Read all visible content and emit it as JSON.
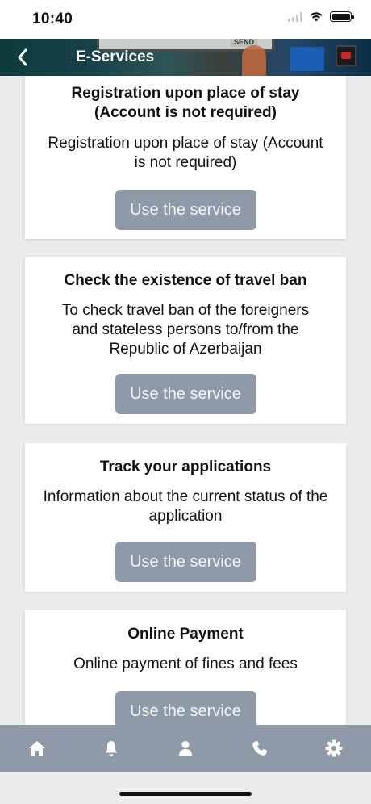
{
  "status_bar": {
    "time": "10:40"
  },
  "header": {
    "title": "E-Services",
    "deco_text": "SEND"
  },
  "cards": [
    {
      "title": "Registration upon place of stay (Account is not required)",
      "description": "Registration upon place of stay (Account is not required)",
      "button": "Use the service"
    },
    {
      "title": "Check the existence of travel ban",
      "description": "To check travel ban of the foreigners and stateless persons to/from the Republic of Azerbaijan",
      "button": "Use the service"
    },
    {
      "title": "Track your applications",
      "description": "Information about the current status of the application",
      "button": "Use the service"
    },
    {
      "title": "Online Payment",
      "description": "Online payment of fines and fees",
      "button": "Use the service"
    }
  ],
  "tab_bar": {
    "items": [
      "home-icon",
      "bell-icon",
      "person-icon",
      "phone-icon",
      "gear-icon"
    ]
  },
  "colors": {
    "button_bg": "#8e9aa8",
    "tab_bar_bg": "#8e9aa8",
    "page_bg": "#ebebed"
  }
}
